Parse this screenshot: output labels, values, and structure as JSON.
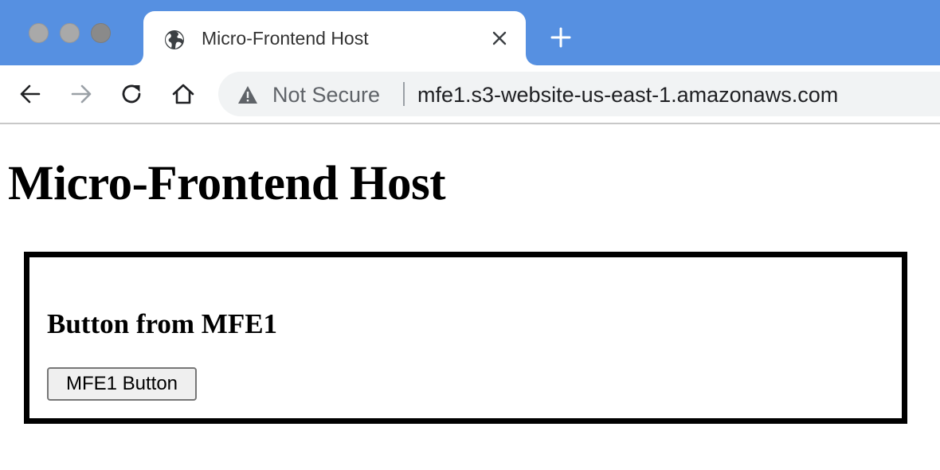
{
  "window": {
    "tab": {
      "title": "Micro-Frontend Host",
      "icon": "globe-icon"
    },
    "colors": {
      "tabstrip": "#5690e1",
      "toolbar": "#ffffff",
      "omnibox": "#f1f3f4"
    }
  },
  "toolbar": {
    "security_label": "Not Secure",
    "url": "mfe1.s3-website-us-east-1.amazonaws.com",
    "icons": [
      "back-arrow-icon",
      "forward-arrow-icon",
      "reload-icon",
      "home-icon",
      "warning-icon"
    ]
  },
  "page": {
    "title": "Micro-Frontend Host",
    "mfe": {
      "heading": "Button from MFE1",
      "button_label": "MFE1 Button"
    }
  }
}
